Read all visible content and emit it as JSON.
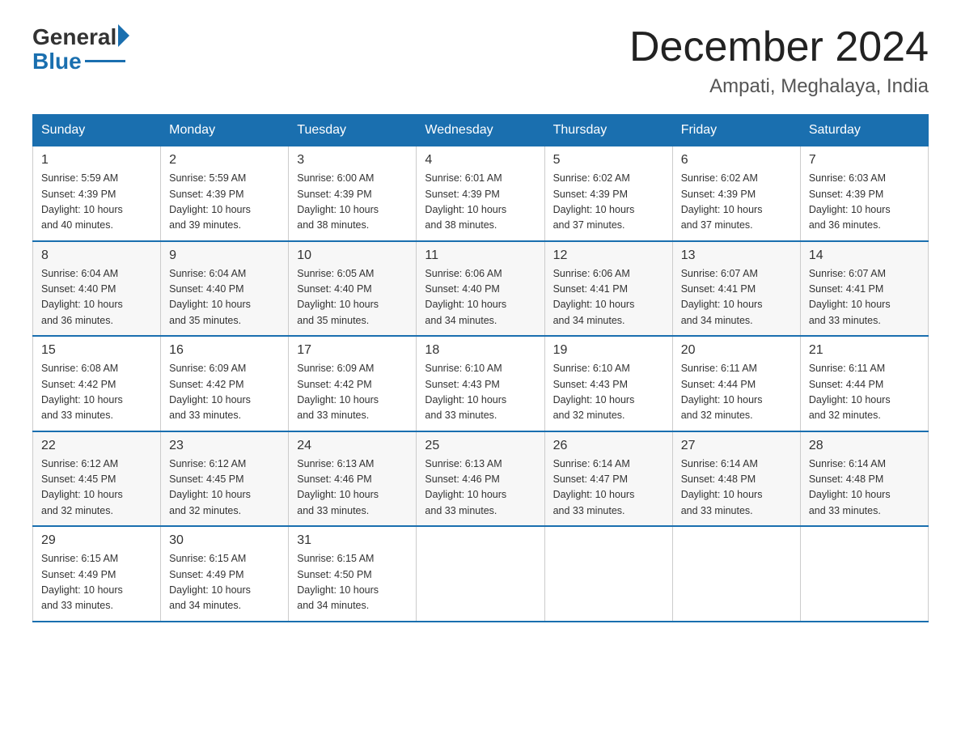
{
  "logo": {
    "general": "General",
    "blue": "Blue"
  },
  "title": "December 2024",
  "subtitle": "Ampati, Meghalaya, India",
  "days": [
    "Sunday",
    "Monday",
    "Tuesday",
    "Wednesday",
    "Thursday",
    "Friday",
    "Saturday"
  ],
  "weeks": [
    [
      {
        "day": "1",
        "sunrise": "5:59 AM",
        "sunset": "4:39 PM",
        "daylight": "10 hours and 40 minutes."
      },
      {
        "day": "2",
        "sunrise": "5:59 AM",
        "sunset": "4:39 PM",
        "daylight": "10 hours and 39 minutes."
      },
      {
        "day": "3",
        "sunrise": "6:00 AM",
        "sunset": "4:39 PM",
        "daylight": "10 hours and 38 minutes."
      },
      {
        "day": "4",
        "sunrise": "6:01 AM",
        "sunset": "4:39 PM",
        "daylight": "10 hours and 38 minutes."
      },
      {
        "day": "5",
        "sunrise": "6:02 AM",
        "sunset": "4:39 PM",
        "daylight": "10 hours and 37 minutes."
      },
      {
        "day": "6",
        "sunrise": "6:02 AM",
        "sunset": "4:39 PM",
        "daylight": "10 hours and 37 minutes."
      },
      {
        "day": "7",
        "sunrise": "6:03 AM",
        "sunset": "4:39 PM",
        "daylight": "10 hours and 36 minutes."
      }
    ],
    [
      {
        "day": "8",
        "sunrise": "6:04 AM",
        "sunset": "4:40 PM",
        "daylight": "10 hours and 36 minutes."
      },
      {
        "day": "9",
        "sunrise": "6:04 AM",
        "sunset": "4:40 PM",
        "daylight": "10 hours and 35 minutes."
      },
      {
        "day": "10",
        "sunrise": "6:05 AM",
        "sunset": "4:40 PM",
        "daylight": "10 hours and 35 minutes."
      },
      {
        "day": "11",
        "sunrise": "6:06 AM",
        "sunset": "4:40 PM",
        "daylight": "10 hours and 34 minutes."
      },
      {
        "day": "12",
        "sunrise": "6:06 AM",
        "sunset": "4:41 PM",
        "daylight": "10 hours and 34 minutes."
      },
      {
        "day": "13",
        "sunrise": "6:07 AM",
        "sunset": "4:41 PM",
        "daylight": "10 hours and 34 minutes."
      },
      {
        "day": "14",
        "sunrise": "6:07 AM",
        "sunset": "4:41 PM",
        "daylight": "10 hours and 33 minutes."
      }
    ],
    [
      {
        "day": "15",
        "sunrise": "6:08 AM",
        "sunset": "4:42 PM",
        "daylight": "10 hours and 33 minutes."
      },
      {
        "day": "16",
        "sunrise": "6:09 AM",
        "sunset": "4:42 PM",
        "daylight": "10 hours and 33 minutes."
      },
      {
        "day": "17",
        "sunrise": "6:09 AM",
        "sunset": "4:42 PM",
        "daylight": "10 hours and 33 minutes."
      },
      {
        "day": "18",
        "sunrise": "6:10 AM",
        "sunset": "4:43 PM",
        "daylight": "10 hours and 33 minutes."
      },
      {
        "day": "19",
        "sunrise": "6:10 AM",
        "sunset": "4:43 PM",
        "daylight": "10 hours and 32 minutes."
      },
      {
        "day": "20",
        "sunrise": "6:11 AM",
        "sunset": "4:44 PM",
        "daylight": "10 hours and 32 minutes."
      },
      {
        "day": "21",
        "sunrise": "6:11 AM",
        "sunset": "4:44 PM",
        "daylight": "10 hours and 32 minutes."
      }
    ],
    [
      {
        "day": "22",
        "sunrise": "6:12 AM",
        "sunset": "4:45 PM",
        "daylight": "10 hours and 32 minutes."
      },
      {
        "day": "23",
        "sunrise": "6:12 AM",
        "sunset": "4:45 PM",
        "daylight": "10 hours and 32 minutes."
      },
      {
        "day": "24",
        "sunrise": "6:13 AM",
        "sunset": "4:46 PM",
        "daylight": "10 hours and 33 minutes."
      },
      {
        "day": "25",
        "sunrise": "6:13 AM",
        "sunset": "4:46 PM",
        "daylight": "10 hours and 33 minutes."
      },
      {
        "day": "26",
        "sunrise": "6:14 AM",
        "sunset": "4:47 PM",
        "daylight": "10 hours and 33 minutes."
      },
      {
        "day": "27",
        "sunrise": "6:14 AM",
        "sunset": "4:48 PM",
        "daylight": "10 hours and 33 minutes."
      },
      {
        "day": "28",
        "sunrise": "6:14 AM",
        "sunset": "4:48 PM",
        "daylight": "10 hours and 33 minutes."
      }
    ],
    [
      {
        "day": "29",
        "sunrise": "6:15 AM",
        "sunset": "4:49 PM",
        "daylight": "10 hours and 33 minutes."
      },
      {
        "day": "30",
        "sunrise": "6:15 AM",
        "sunset": "4:49 PM",
        "daylight": "10 hours and 34 minutes."
      },
      {
        "day": "31",
        "sunrise": "6:15 AM",
        "sunset": "4:50 PM",
        "daylight": "10 hours and 34 minutes."
      },
      null,
      null,
      null,
      null
    ]
  ],
  "labels": {
    "sunrise": "Sunrise:",
    "sunset": "Sunset:",
    "daylight": "Daylight:"
  }
}
